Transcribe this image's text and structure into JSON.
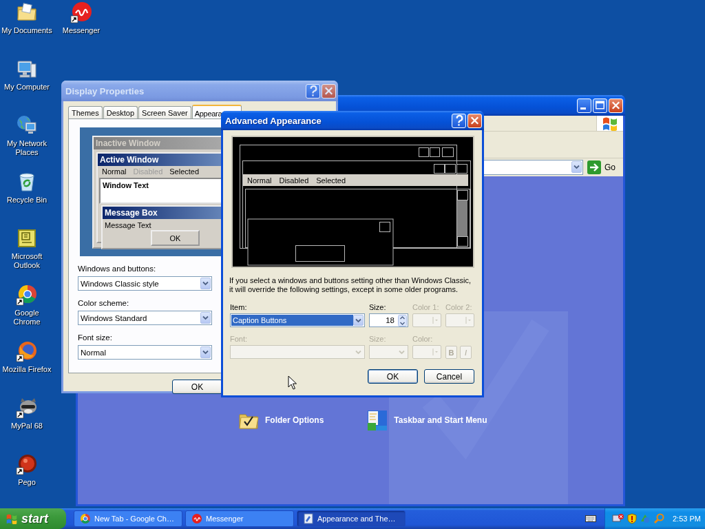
{
  "desktop_icons": {
    "columns": [
      [
        {
          "label": "My Documents"
        },
        {
          "label": "My Computer"
        },
        {
          "label": "My Network Places"
        },
        {
          "label": "Recycle Bin"
        },
        {
          "label": "Microsoft Outlook"
        },
        {
          "label": "Google Chrome"
        },
        {
          "label": "Mozilla Firefox"
        },
        {
          "label": "MyPal 68"
        },
        {
          "label": "Pego"
        }
      ],
      [
        {
          "label": "Messenger"
        }
      ]
    ]
  },
  "control_panel": {
    "go": "Go",
    "tasks": [
      {
        "label": "Folder Options"
      },
      {
        "label": "Taskbar and Start Menu"
      }
    ]
  },
  "display_properties": {
    "title": "Display Properties",
    "tabs": [
      {
        "label": "Themes",
        "selected": false
      },
      {
        "label": "Desktop",
        "selected": false
      },
      {
        "label": "Screen Saver",
        "selected": false
      },
      {
        "label": "Appeara",
        "selected": true
      }
    ],
    "preview": {
      "inactive_title": "Inactive Window",
      "active_title": "Active Window",
      "menu": [
        {
          "label": "Normal",
          "disabled": false
        },
        {
          "label": "Disabled",
          "disabled": true
        },
        {
          "label": "Selected",
          "disabled": false
        }
      ],
      "window_text": "Window Text",
      "message_title": "Message Box",
      "message_text": "Message Text",
      "ok": "OK"
    },
    "fields": [
      {
        "label": "Windows and buttons:",
        "value": "Windows Classic style"
      },
      {
        "label": "Color scheme:",
        "value": "Windows Standard"
      },
      {
        "label": "Font size:",
        "value": "Normal"
      }
    ],
    "buttons": [
      "OK"
    ]
  },
  "advanced": {
    "title": "Advanced Appearance",
    "preview_menu": [
      "Normal",
      "Disabled",
      "Selected"
    ],
    "note": "If you select a windows and buttons setting other than Windows Classic, it will override the following settings, except in some older programs.",
    "rows": [
      [
        {
          "kind": "select",
          "label": "Item:",
          "value": "Caption Buttons",
          "disabled": false,
          "focused": true
        },
        {
          "kind": "spin",
          "label": "Size:",
          "value": "18",
          "disabled": false
        },
        {
          "kind": "color",
          "label": "Color 1:",
          "disabled": true
        },
        {
          "kind": "color",
          "label": "Color 2:",
          "disabled": true
        }
      ],
      [
        {
          "kind": "select",
          "label": "Font:",
          "disabled": true,
          "focused": false
        },
        {
          "kind": "select",
          "label": "Size:",
          "disabled": true,
          "focused": false
        },
        {
          "kind": "color",
          "label": "Color:",
          "disabled": true
        },
        {
          "kind": "toggle",
          "value": "B",
          "disabled": true
        },
        {
          "kind": "toggle",
          "value": "I",
          "disabled": true
        }
      ]
    ],
    "buttons": [
      {
        "label": "OK",
        "default": true
      },
      {
        "label": "Cancel",
        "default": false
      }
    ]
  },
  "taskbar": {
    "start": "start",
    "tasks": [
      {
        "label": "New Tab - Google Ch…",
        "selected": false
      },
      {
        "label": "Messenger",
        "selected": false
      },
      {
        "label": "Appearance and The…",
        "selected": true
      }
    ],
    "clock": "2:53 PM"
  }
}
